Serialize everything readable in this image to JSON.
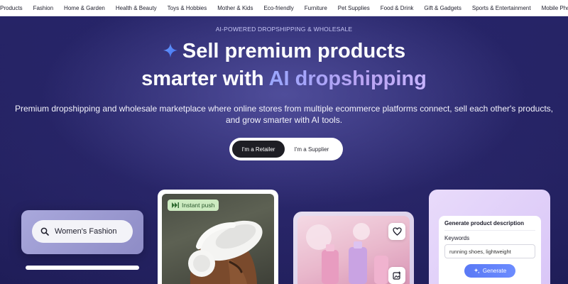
{
  "nav": {
    "items": [
      "l Products",
      "Fashion",
      "Home & Garden",
      "Health & Beauty",
      "Toys & Hobbies",
      "Mother & Kids",
      "Eco-friendly",
      "Furniture",
      "Pet Supplies",
      "Food & Drink",
      "Gift & Gadgets",
      "Sports & Entertainment",
      "Mobile Pho"
    ]
  },
  "hero": {
    "eyebrow": "AI-POWERED DROPSHIPPING & WHOLESALE",
    "headline_line1": "Sell premium products",
    "headline_line2_prefix": "smarter with ",
    "headline_line2_highlight": "AI dropshipping",
    "subtitle": "Premium dropshipping and wholesale marketplace where online stores from multiple ecommerce platforms connect, sell each other's products, and grow smarter with AI tools.",
    "toggle": {
      "retailer": "I'm a Retailer",
      "supplier": "I'm a Supplier",
      "selected": "retailer"
    }
  },
  "cards": {
    "search_text": "Women's Fashion",
    "instant_push": "Instant push",
    "generator": {
      "title": "Generate product description",
      "keywords_label": "Keywords",
      "keywords_value": "running shoes, lightweight",
      "button": "Generate"
    }
  },
  "colors": {
    "background": "#1e1c52",
    "accent_blue": "#5a79f5",
    "highlight_gradient_start": "#9aa6ff",
    "highlight_gradient_end": "#c7b4ff",
    "badge_green": "#cdebc1"
  }
}
